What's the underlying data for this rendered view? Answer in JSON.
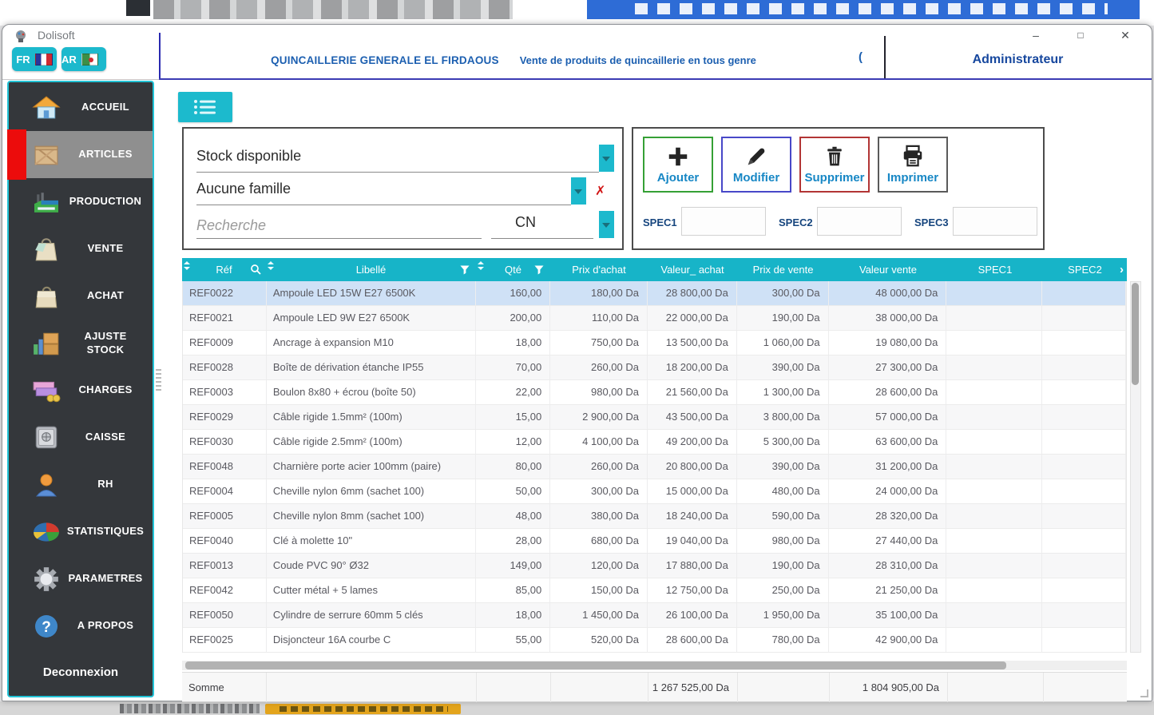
{
  "window": {
    "title": "Dolisoft",
    "controls": {
      "minimize": "–",
      "maximize": "□",
      "close": "✕"
    }
  },
  "header": {
    "lang_fr": "FR",
    "lang_ar": "AR",
    "company": "QUINCAILLERIE GENERALE EL FIRDAOUS",
    "subtitle": "Vente de produits de quincaillerie en tous genre",
    "paren": "(",
    "user": "Administrateur"
  },
  "sidebar": {
    "items": [
      {
        "label": "ACCUEIL",
        "icon": "home-icon"
      },
      {
        "label": "ARTICLES",
        "icon": "crate-icon",
        "selected": true
      },
      {
        "label": "PRODUCTION",
        "icon": "factory-icon"
      },
      {
        "label": "VENTE",
        "icon": "sale-bag-icon"
      },
      {
        "label": "ACHAT",
        "icon": "purchase-bag-icon"
      },
      {
        "label": "AJUSTE STOCK",
        "icon": "stock-boxes-icon"
      },
      {
        "label": "CHARGES",
        "icon": "banknotes-icon"
      },
      {
        "label": "CAISSE",
        "icon": "safe-icon"
      },
      {
        "label": "RH",
        "icon": "person-icon"
      },
      {
        "label": "STATISTIQUES",
        "icon": "pie-chart-icon"
      },
      {
        "label": "PARAMETRES",
        "icon": "gear-icon"
      },
      {
        "label": "A PROPOS",
        "icon": "question-icon"
      }
    ],
    "logout": "Deconnexion"
  },
  "filters": {
    "stock": "Stock disponible",
    "famille": "Aucune famille",
    "search_placeholder": "Recherche",
    "search_mode": "CN",
    "clear_icon": "✗"
  },
  "actions": [
    {
      "label": "Ajouter",
      "icon": "plus-icon",
      "border": "#35a035"
    },
    {
      "label": "Modifier",
      "icon": "pencil-icon",
      "border": "#4848c8"
    },
    {
      "label": "Supprimer",
      "icon": "trash-icon",
      "border": "#b23535"
    },
    {
      "label": "Imprimer",
      "icon": "printer-icon",
      "border": "#5a5a5a"
    }
  ],
  "specs": {
    "spec1": "SPEC1",
    "spec2": "SPEC2",
    "spec3": "SPEC3"
  },
  "table": {
    "columns": [
      {
        "key": "ref",
        "label": "Réf",
        "align": "left"
      },
      {
        "key": "libelle",
        "label": "Libellé",
        "align": "left"
      },
      {
        "key": "qte",
        "label": "Qté",
        "align": "right"
      },
      {
        "key": "prix_achat",
        "label": "Prix d'achat",
        "align": "right"
      },
      {
        "key": "valeur_achat",
        "label": "Valeur_ achat",
        "align": "right"
      },
      {
        "key": "prix_vente",
        "label": "Prix de vente",
        "align": "right"
      },
      {
        "key": "valeur_vente",
        "label": "Valeur vente",
        "align": "right"
      },
      {
        "key": "spec1",
        "label": "SPEC1",
        "align": "left"
      },
      {
        "key": "spec2",
        "label": "SPEC2",
        "align": "left"
      }
    ],
    "selected_row": 0,
    "rows": [
      [
        "REF0022",
        "Ampoule LED 15W E27 6500K",
        "160,00",
        "180,00 Da",
        "28 800,00 Da",
        "300,00 Da",
        "48 000,00 Da",
        "",
        ""
      ],
      [
        "REF0021",
        "Ampoule LED 9W E27 6500K",
        "200,00",
        "110,00 Da",
        "22 000,00 Da",
        "190,00 Da",
        "38 000,00 Da",
        "",
        ""
      ],
      [
        "REF0009",
        "Ancrage à expansion M10",
        "18,00",
        "750,00 Da",
        "13 500,00 Da",
        "1 060,00 Da",
        "19 080,00 Da",
        "",
        ""
      ],
      [
        "REF0028",
        "Boîte de dérivation étanche IP55",
        "70,00",
        "260,00 Da",
        "18 200,00 Da",
        "390,00 Da",
        "27 300,00 Da",
        "",
        ""
      ],
      [
        "REF0003",
        "Boulon 8x80 + écrou (boîte 50)",
        "22,00",
        "980,00 Da",
        "21 560,00 Da",
        "1 300,00 Da",
        "28 600,00 Da",
        "",
        ""
      ],
      [
        "REF0029",
        "Câble rigide 1.5mm² (100m)",
        "15,00",
        "2 900,00 Da",
        "43 500,00 Da",
        "3 800,00 Da",
        "57 000,00 Da",
        "",
        ""
      ],
      [
        "REF0030",
        "Câble rigide 2.5mm² (100m)",
        "12,00",
        "4 100,00 Da",
        "49 200,00 Da",
        "5 300,00 Da",
        "63 600,00 Da",
        "",
        ""
      ],
      [
        "REF0048",
        "Charnière porte acier 100mm (paire)",
        "80,00",
        "260,00 Da",
        "20 800,00 Da",
        "390,00 Da",
        "31 200,00 Da",
        "",
        ""
      ],
      [
        "REF0004",
        "Cheville nylon 6mm (sachet 100)",
        "50,00",
        "300,00 Da",
        "15 000,00 Da",
        "480,00 Da",
        "24 000,00 Da",
        "",
        ""
      ],
      [
        "REF0005",
        "Cheville nylon 8mm (sachet 100)",
        "48,00",
        "380,00 Da",
        "18 240,00 Da",
        "590,00 Da",
        "28 320,00 Da",
        "",
        ""
      ],
      [
        "REF0040",
        "Clé à molette 10\"",
        "28,00",
        "680,00 Da",
        "19 040,00 Da",
        "980,00 Da",
        "27 440,00 Da",
        "",
        ""
      ],
      [
        "REF0013",
        "Coude PVC 90° Ø32",
        "149,00",
        "120,00 Da",
        "17 880,00 Da",
        "190,00 Da",
        "28 310,00 Da",
        "",
        ""
      ],
      [
        "REF0042",
        "Cutter métal + 5 lames",
        "85,00",
        "150,00 Da",
        "12 750,00 Da",
        "250,00 Da",
        "21 250,00 Da",
        "",
        ""
      ],
      [
        "REF0050",
        "Cylindre de serrure 60mm 5 clés",
        "18,00",
        "1 450,00 Da",
        "26 100,00 Da",
        "1 950,00 Da",
        "35 100,00 Da",
        "",
        ""
      ],
      [
        "REF0025",
        "Disjoncteur 16A courbe C",
        "55,00",
        "520,00 Da",
        "28 600,00 Da",
        "780,00 Da",
        "42 900,00 Da",
        "",
        ""
      ]
    ],
    "sum_label": "Somme",
    "sum_achat": "1 267 525,00 Da",
    "sum_vente": "1 804 905,00 Da"
  },
  "colors": {
    "accent_cyan": "#17b4c8",
    "sidebar_bg": "#34373b",
    "selected_red": "#ec0c0c",
    "selected_row": "#cfe1f6",
    "header_blue_text": "#1c5fb0",
    "button_label_blue": "#1787c5"
  }
}
